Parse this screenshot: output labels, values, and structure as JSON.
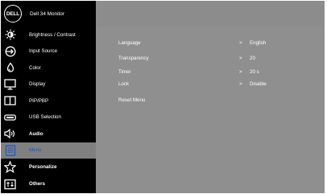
{
  "header": {
    "logo_text": "DELL",
    "model": "Dell 34 Monitor"
  },
  "sidebar": {
    "items": [
      {
        "label": "Brightness / Contrast",
        "icon": "sun-icon"
      },
      {
        "label": "Input Source",
        "icon": "input-arrow-icon"
      },
      {
        "label": "Color",
        "icon": "color-drop-icon"
      },
      {
        "label": "Display",
        "icon": "monitor-icon"
      },
      {
        "label": "PIP/PBP",
        "icon": "pip-icon"
      },
      {
        "label": "USB Selection",
        "icon": "usb-icon"
      },
      {
        "label": "Audio",
        "icon": "speaker-icon"
      },
      {
        "label": "Menu",
        "icon": "menu-icon",
        "selected": true
      },
      {
        "label": "Personalize",
        "icon": "star-icon"
      },
      {
        "label": "Others",
        "icon": "others-icon"
      }
    ]
  },
  "menu_settings": {
    "rows": [
      {
        "label": "Language",
        "arrow": ">",
        "value": "English"
      },
      {
        "label": "Transparency",
        "arrow": ">",
        "value": "20"
      },
      {
        "label": "Timer",
        "arrow": ">",
        "value": "20 s"
      },
      {
        "label": "Lock",
        "arrow": ">",
        "value": "Disable"
      },
      {
        "label": "Reset Menu"
      }
    ]
  },
  "colors": {
    "sidebar_bg": "#000000",
    "panel_bg": "#8f8f8f",
    "selected_item_bg": "#808080",
    "selected_label": "#1a55c9"
  }
}
